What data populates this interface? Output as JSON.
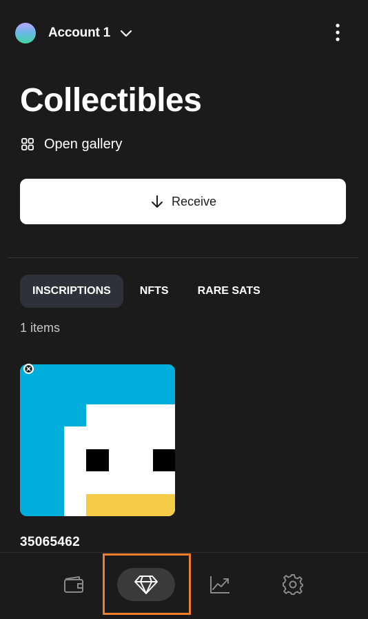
{
  "header": {
    "account_name": "Account 1",
    "avatar_icon": "gradient-avatar",
    "dropdown_icon": "chevron-down-icon",
    "menu_icon": "more-vertical-icon"
  },
  "page": {
    "title": "Collectibles",
    "gallery_link": "Open gallery",
    "gallery_icon": "grid-icon",
    "receive_button": "Receive",
    "receive_icon": "arrow-down-icon"
  },
  "tabs": [
    {
      "label": "INSCRIPTIONS",
      "active": true
    },
    {
      "label": "NFTS",
      "active": false
    },
    {
      "label": "RARE SATS",
      "active": false
    }
  ],
  "items_count": "1 items",
  "inscriptions": [
    {
      "id": "35065462",
      "image": "pixel-duck-art"
    }
  ],
  "bottom_nav": [
    {
      "name": "wallet",
      "icon": "wallet-icon",
      "active": false
    },
    {
      "name": "collectibles",
      "icon": "diamond-icon",
      "active": true
    },
    {
      "name": "stacking",
      "icon": "chart-icon",
      "active": false
    },
    {
      "name": "settings",
      "icon": "gear-icon",
      "active": false
    }
  ],
  "colors": {
    "background": "#1b1b1b",
    "active_tab": "#2f3039",
    "nav_active": "#3a3a3a",
    "highlight": "#f07e2a",
    "art_blue": "#00aedb",
    "art_yellow": "#f5cc48"
  }
}
